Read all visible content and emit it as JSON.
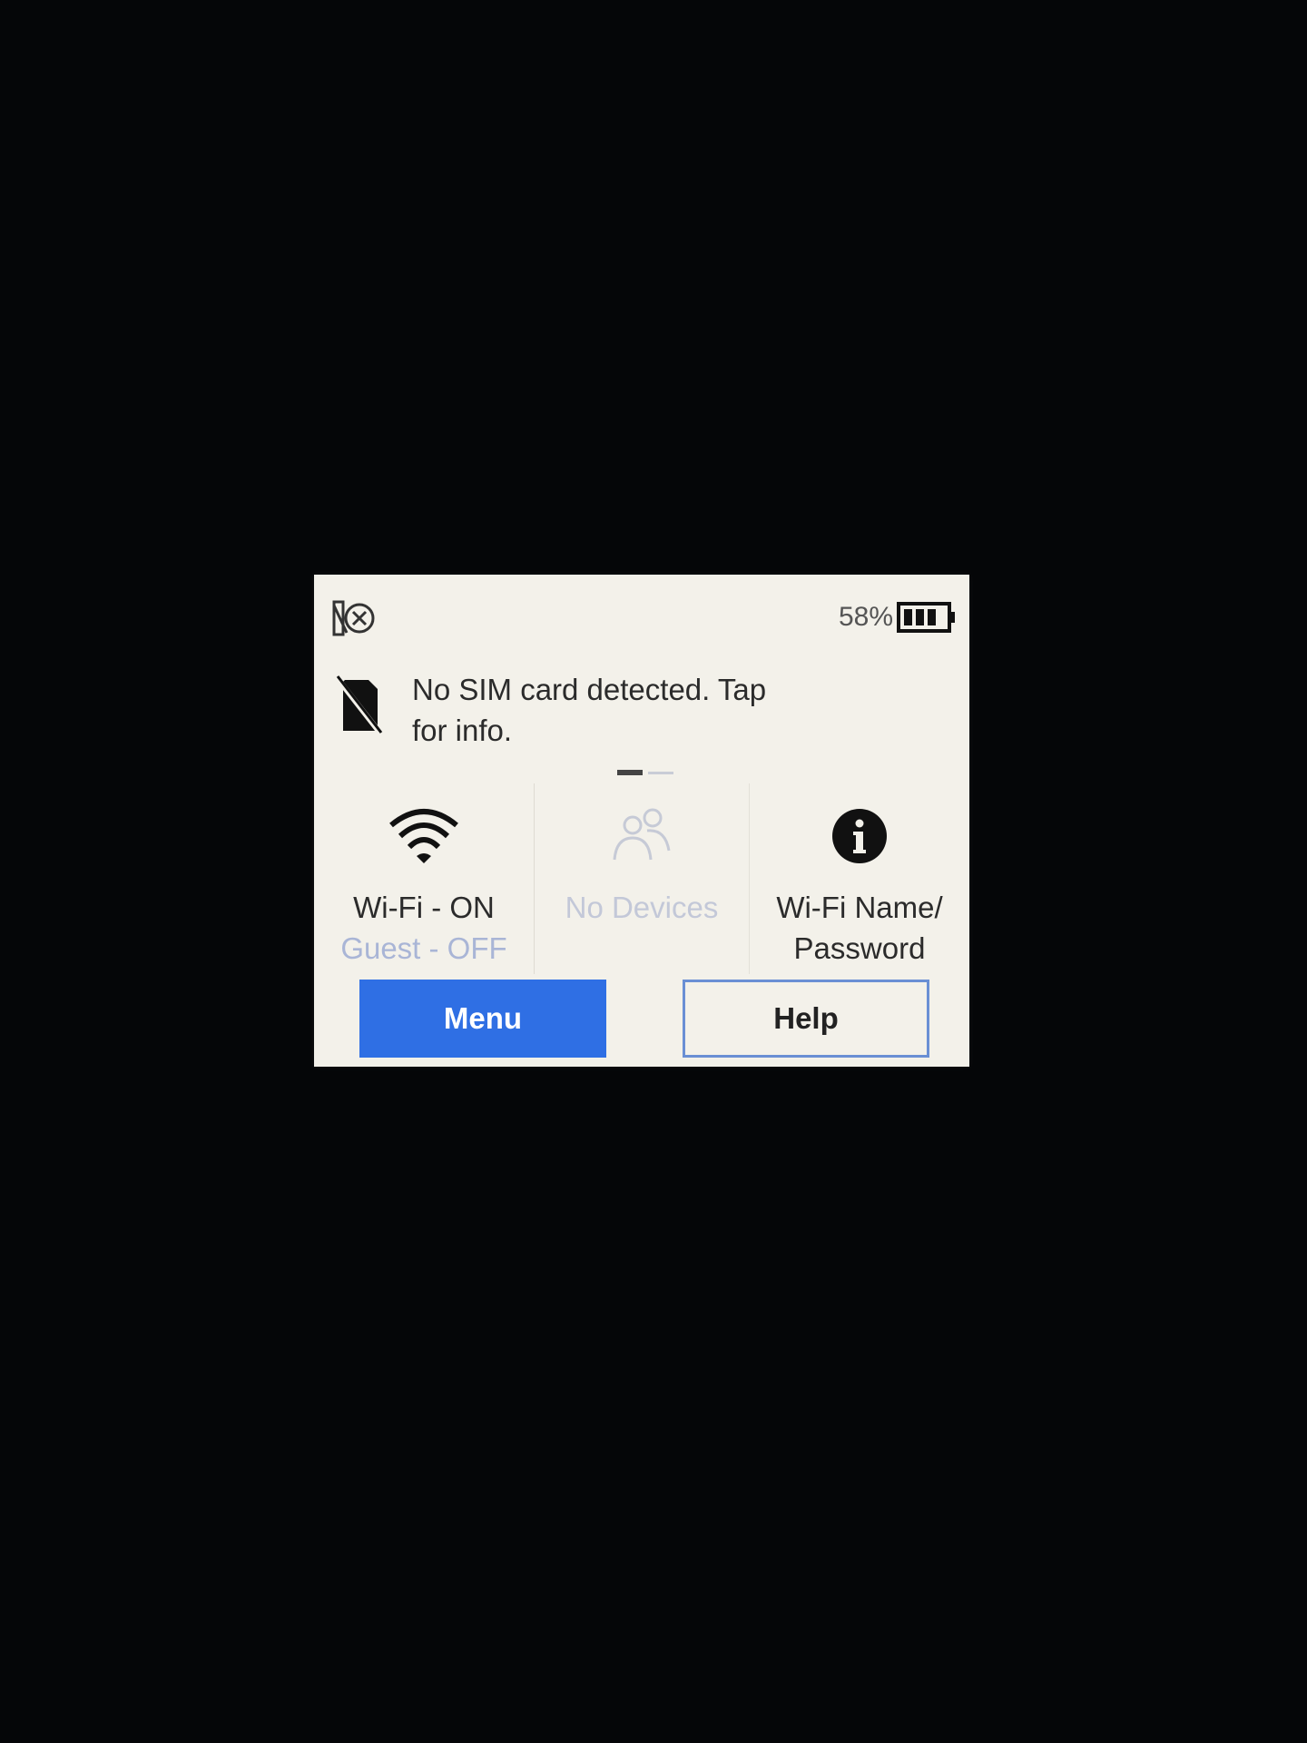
{
  "status_bar": {
    "service_icon": "no-service-icon",
    "battery_percent": "58%",
    "battery_icon": "battery-icon",
    "battery_level": 0.58
  },
  "notification": {
    "icon": "no-sim-icon",
    "line1": "No SIM card detected. Tap",
    "line2": "for info."
  },
  "pager": {
    "pages": 2,
    "current": 1
  },
  "tiles": [
    {
      "icon": "wifi-icon",
      "line1": "Wi-Fi - ON",
      "line2": "Guest - OFF"
    },
    {
      "icon": "devices-icon",
      "line1": "No Devices"
    },
    {
      "icon": "info-icon",
      "line1": "Wi-Fi Name/",
      "line2": "Password"
    }
  ],
  "buttons": {
    "menu_label": "Menu",
    "help_label": "Help"
  },
  "colors": {
    "screen_background": "#f3f1ea",
    "accent_blue": "#2f6fe4",
    "help_border": "#6a8fd4",
    "disabled_text": "#c3c8d8"
  }
}
